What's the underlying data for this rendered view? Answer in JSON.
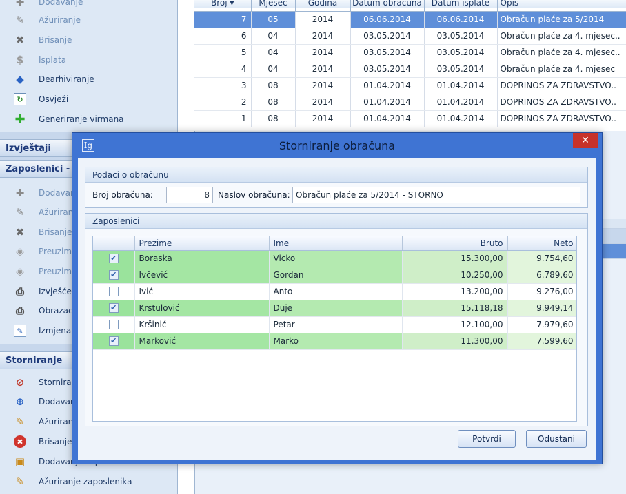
{
  "sidebar": {
    "top_items": [
      {
        "label": "Dodavanje",
        "icon": "plus-icon"
      },
      {
        "label": "Ažuriranje",
        "icon": "edit-icon"
      },
      {
        "label": "Brisanje",
        "icon": "delete-x-icon"
      },
      {
        "label": "Isplata",
        "icon": "dollar-icon"
      },
      {
        "label": "Dearhiviranje",
        "icon": "book-icon"
      },
      {
        "label": "Osvježi",
        "icon": "refresh-icon"
      },
      {
        "label": "Generiranje virmana",
        "icon": "green-plus-icon"
      }
    ],
    "section_izvjestaji": "Izvještaji",
    "section_zaposlenici": "Zaposlenici - p",
    "zap_items": [
      {
        "label": "Dodavar"
      },
      {
        "label": "Ažuriran"
      },
      {
        "label": "Brisanje"
      },
      {
        "label": "Preuzima"
      },
      {
        "label": "Preuzima"
      },
      {
        "label": "Izvješće"
      },
      {
        "label": "Obrazac"
      },
      {
        "label": "Izmjena"
      }
    ],
    "section_storniranje": "Storniranje",
    "storno_items": [
      {
        "label": "Stornira"
      },
      {
        "label": "Dodavar"
      },
      {
        "label": "Ažuriran"
      },
      {
        "label": "Brisanje"
      },
      {
        "label": "Dodavanje zaposlenika"
      },
      {
        "label": "Ažuriranje zaposlenika"
      }
    ]
  },
  "grid": {
    "columns": [
      "Broj ▾",
      "Mjesec",
      "Godina",
      "Datum obračuna",
      "Datum isplate",
      "Opis"
    ],
    "rows": [
      [
        "7",
        "05",
        "2014",
        "06.06.2014",
        "06.06.2014",
        "Obračun plaće za 5/2014"
      ],
      [
        "6",
        "04",
        "2014",
        "03.05.2014",
        "03.05.2014",
        "Obračun plaće za 4. mjesec.."
      ],
      [
        "5",
        "04",
        "2014",
        "03.05.2014",
        "03.05.2014",
        "Obračun plaće za 4. mjesec.."
      ],
      [
        "4",
        "04",
        "2014",
        "03.05.2014",
        "03.05.2014",
        "Obračun plaće za 4. mjesec"
      ],
      [
        "3",
        "08",
        "2014",
        "01.04.2014",
        "01.04.2014",
        "DOPRINOS ZA ZDRAVSTVO.."
      ],
      [
        "2",
        "08",
        "2014",
        "01.04.2014",
        "01.04.2014",
        "DOPRINOS ZA ZDRAVSTVO.."
      ],
      [
        "1",
        "08",
        "2014",
        "01.04.2014",
        "01.04.2014",
        "DOPRINOS ZA ZDRAVSTVO.."
      ]
    ]
  },
  "dialog": {
    "logo": "Ig",
    "title": "Storniranje obračuna",
    "close": "✕",
    "group1_title": "Podaci o obračunu",
    "broj_label": "Broj obračuna:",
    "broj_value": "8",
    "naslov_label": "Naslov obračuna:",
    "naslov_value": "Obračun plaće za 5/2014 - STORNO",
    "group2_title": "Zaposlenici",
    "emp_columns": [
      "",
      "Prezime",
      "Ime",
      "Bruto",
      "Neto"
    ],
    "employees": [
      {
        "checked": true,
        "prezime": "Boraska",
        "ime": "Vicko",
        "bruto": "15.300,00",
        "neto": "9.754,60"
      },
      {
        "checked": true,
        "prezime": "Ivčević",
        "ime": "Gordan",
        "bruto": "10.250,00",
        "neto": "6.789,60"
      },
      {
        "checked": false,
        "prezime": "Ivić",
        "ime": "Anto",
        "bruto": "13.200,00",
        "neto": "9.276,00"
      },
      {
        "checked": true,
        "prezime": "Krstulović",
        "ime": "Duje",
        "bruto": "15.118,18",
        "neto": "9.949,14"
      },
      {
        "checked": false,
        "prezime": "Kršinić",
        "ime": "Petar",
        "bruto": "12.100,00",
        "neto": "7.979,60"
      },
      {
        "checked": true,
        "prezime": "Marković",
        "ime": "Marko",
        "bruto": "11.300,00",
        "neto": "7.599,60"
      }
    ],
    "confirm_label": "Potvrdi",
    "cancel_label": "Odustani"
  },
  "colors": {
    "selection": "#5f8fd9",
    "dialog_frame": "#3f74d3",
    "checked_row": "#98e39a",
    "close_button": "#c7322a"
  }
}
